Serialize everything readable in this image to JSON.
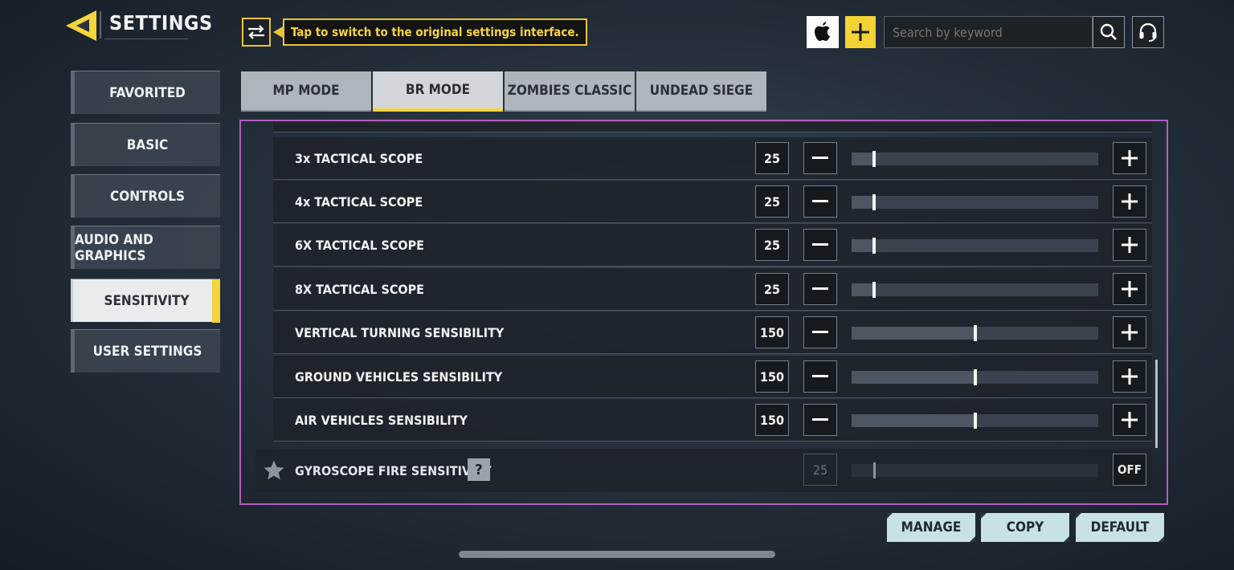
{
  "header": {
    "title": "SETTINGS",
    "switch_tip": "Tap to switch to the original settings interface.",
    "search_placeholder": "Search by keyword"
  },
  "sidebar": {
    "items": [
      {
        "label": "FAVORITED"
      },
      {
        "label": "BASIC"
      },
      {
        "label": "CONTROLS"
      },
      {
        "label": "AUDIO AND GRAPHICS"
      },
      {
        "label": "SENSITIVITY",
        "active": true
      },
      {
        "label": "USER SETTINGS"
      }
    ]
  },
  "tabs": [
    {
      "label": "MP MODE"
    },
    {
      "label": "BR MODE",
      "active": true
    },
    {
      "label": "ZOMBIES CLASSIC"
    },
    {
      "label": "UNDEAD SIEGE"
    }
  ],
  "rows": [
    {
      "label": "3x TACTICAL SCOPE",
      "value": "25",
      "level": 0.09
    },
    {
      "label": "4x TACTICAL SCOPE",
      "value": "25",
      "level": 0.09
    },
    {
      "label": "6X TACTICAL SCOPE",
      "value": "25",
      "level": 0.09
    },
    {
      "label": "8X TACTICAL SCOPE",
      "value": "25",
      "level": 0.09
    },
    {
      "label": "VERTICAL TURNING SENSIBILITY",
      "value": "150",
      "level": 0.5
    },
    {
      "label": "GROUND VEHICLES SENSIBILITY",
      "value": "150",
      "level": 0.5
    },
    {
      "label": "AIR VEHICLES SENSIBILITY",
      "value": "150",
      "level": 0.5
    }
  ],
  "gyroscope": {
    "label": "GYROSCOPE FIRE SENSITIVITY",
    "help": "?",
    "value": "25",
    "toggle": "OFF"
  },
  "buttons": {
    "manage": "MANAGE",
    "copy": "COPY",
    "default": "DEFAULT"
  },
  "colors": {
    "accent": "#f4d53a",
    "panel_outline": "#b45dbb",
    "button_bg": "#c7e1e6"
  }
}
